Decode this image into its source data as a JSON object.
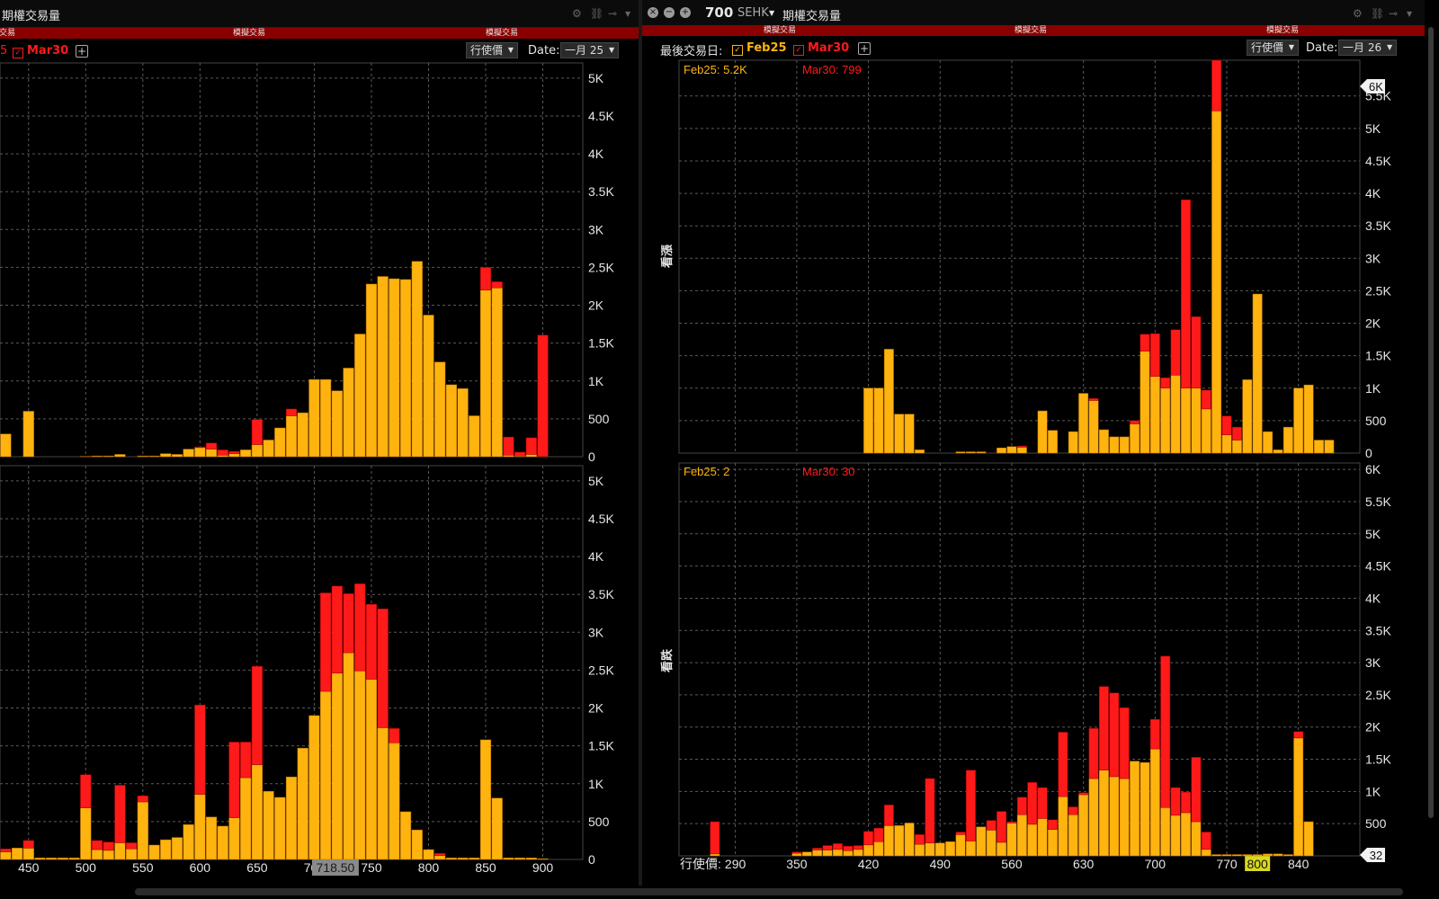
{
  "left_window": {
    "title": "期權交易量",
    "red_bar_labels": [
      "交易",
      "模擬交易",
      "模擬交易"
    ],
    "expiry_partial": "5",
    "expiry_mar": "Mar30",
    "sort_dropdown": "行使價",
    "date_label": "Date:",
    "date_value": "一月 25",
    "cursor_price": "718.50"
  },
  "right_window": {
    "symbol": "700",
    "exchange": "SEHK",
    "title": "期權交易量",
    "red_bar_labels": [
      "模擬交易",
      "模擬交易",
      "模擬交易"
    ],
    "expiry_label": "最後交易日:",
    "expiry_feb": "Feb25",
    "expiry_mar": "Mar30",
    "sort_dropdown": "行使價",
    "date_label": "Date:",
    "date_value": "一月 26",
    "top_chart": {
      "side_label": "看漲",
      "legend_feb": "Feb25: 5.2K",
      "legend_mar": "Mar30: 799",
      "max_marker": "6K",
      "extra_tick": "6K"
    },
    "bottom_chart": {
      "side_label": "看跌",
      "legend_feb": "Feb25: 2",
      "legend_mar": "Mar30: 30",
      "min_marker": "32"
    },
    "x_axis_title": "行使價",
    "highlight_tick": "800"
  },
  "icons": [
    "gear-icon",
    "link-icon",
    "pin-icon",
    "chevron-down-icon",
    "plus-icon",
    "close-icon",
    "minimize-icon",
    "zoom-icon"
  ],
  "colors": {
    "feb": "#FFB30F",
    "mar": "#FF1A1A",
    "red_bar": "#8a0000",
    "grid": "#5a5a5a",
    "highlight": "#d8d820"
  },
  "chart_data": [
    {
      "type": "bar",
      "stacked": true,
      "title": "",
      "panel": "left-top",
      "x_ticks": [
        450,
        500,
        550,
        600,
        650,
        700,
        750,
        800,
        850,
        900
      ],
      "xlim": [
        425,
        935
      ],
      "ylim": [
        0,
        5200
      ],
      "y_ticks": [
        "0",
        "500",
        "1K",
        "1.5K",
        "2K",
        "2.5K",
        "3K",
        "3.5K",
        "4K",
        "4.5K",
        "5K"
      ],
      "x": [
        430,
        440,
        450,
        460,
        470,
        480,
        490,
        500,
        510,
        520,
        530,
        540,
        550,
        560,
        570,
        580,
        590,
        600,
        610,
        620,
        630,
        640,
        650,
        660,
        670,
        680,
        690,
        700,
        710,
        720,
        730,
        740,
        750,
        760,
        770,
        780,
        790,
        800,
        810,
        820,
        830,
        840,
        850,
        860,
        870,
        880,
        890,
        900
      ],
      "series": [
        {
          "name": "Feb25",
          "values": [
            300,
            0,
            600,
            0,
            0,
            0,
            0,
            5,
            10,
            10,
            30,
            0,
            10,
            10,
            40,
            30,
            100,
            120,
            100,
            20,
            40,
            90,
            160,
            220,
            380,
            540,
            580,
            1020,
            1020,
            870,
            1170,
            1620,
            2280,
            2380,
            2350,
            2340,
            2580,
            1870,
            1250,
            950,
            900,
            540,
            2200,
            2230,
            20,
            10,
            30,
            5
          ]
        },
        {
          "name": "Mar30",
          "values": [
            0,
            0,
            0,
            0,
            0,
            0,
            0,
            0,
            0,
            0,
            0,
            0,
            0,
            0,
            0,
            0,
            0,
            10,
            80,
            70,
            30,
            0,
            330,
            0,
            0,
            90,
            0,
            0,
            0,
            0,
            0,
            0,
            0,
            0,
            0,
            0,
            0,
            0,
            0,
            0,
            0,
            0,
            300,
            80,
            240,
            50,
            220,
            1600
          ]
        }
      ]
    },
    {
      "type": "bar",
      "stacked": true,
      "title": "",
      "panel": "left-bottom",
      "x_ticks": [
        450,
        500,
        550,
        600,
        650,
        700,
        750,
        800,
        850,
        900
      ],
      "xlim": [
        425,
        935
      ],
      "ylim": [
        0,
        5200
      ],
      "y_ticks": [
        "0",
        "500",
        "1K",
        "1.5K",
        "2K",
        "2.5K",
        "3K",
        "3.5K",
        "4K",
        "4.5K",
        "5K"
      ],
      "x": [
        430,
        440,
        450,
        460,
        470,
        480,
        490,
        500,
        510,
        520,
        530,
        540,
        550,
        560,
        570,
        580,
        590,
        600,
        610,
        620,
        630,
        640,
        650,
        660,
        670,
        680,
        690,
        700,
        710,
        720,
        730,
        740,
        750,
        760,
        770,
        780,
        790,
        800,
        810,
        820,
        830,
        840,
        850,
        860,
        870,
        880,
        890,
        900
      ],
      "series": [
        {
          "name": "Feb25",
          "values": [
            100,
            150,
            150,
            20,
            20,
            20,
            20,
            680,
            130,
            120,
            220,
            140,
            760,
            190,
            260,
            290,
            460,
            860,
            560,
            440,
            550,
            1080,
            1250,
            900,
            820,
            1090,
            1470,
            1900,
            2220,
            2460,
            2730,
            2490,
            2380,
            1740,
            1540,
            630,
            390,
            130,
            50,
            20,
            20,
            20,
            1580,
            810,
            20,
            20,
            20,
            10
          ]
        },
        {
          "name": "Mar30",
          "values": [
            40,
            0,
            100,
            0,
            0,
            0,
            0,
            440,
            120,
            110,
            760,
            80,
            80,
            0,
            0,
            0,
            0,
            1180,
            0,
            0,
            1000,
            470,
            1300,
            0,
            0,
            0,
            0,
            0,
            1300,
            1150,
            780,
            1150,
            990,
            1570,
            190,
            0,
            0,
            0,
            30,
            0,
            0,
            0,
            0,
            0,
            0,
            0,
            0,
            0
          ]
        }
      ]
    },
    {
      "type": "bar",
      "stacked": true,
      "title": "",
      "panel": "right-top",
      "x_ticks": [
        290,
        350,
        420,
        490,
        560,
        630,
        700,
        770,
        840
      ],
      "xlim": [
        235,
        900
      ],
      "ylim": [
        0,
        6050
      ],
      "y_ticks": [
        "0",
        "500",
        "1K",
        "1.5K",
        "2K",
        "2.5K",
        "3K",
        "3.5K",
        "4K",
        "4.5K",
        "5K",
        "5.5K"
      ],
      "x": [
        400,
        410,
        420,
        430,
        440,
        450,
        460,
        470,
        480,
        490,
        500,
        510,
        520,
        530,
        540,
        550,
        560,
        570,
        580,
        590,
        600,
        610,
        620,
        630,
        640,
        650,
        660,
        670,
        680,
        690,
        700,
        710,
        720,
        730,
        740,
        750,
        760,
        770,
        780,
        790,
        800,
        810,
        820,
        830,
        840,
        850,
        860,
        870,
        880
      ],
      "series": [
        {
          "name": "Feb25",
          "values": [
            0,
            0,
            1000,
            1000,
            1600,
            600,
            600,
            50,
            0,
            0,
            0,
            20,
            20,
            20,
            0,
            80,
            100,
            90,
            0,
            650,
            350,
            0,
            330,
            920,
            810,
            360,
            250,
            250,
            450,
            1570,
            1180,
            1000,
            1200,
            1000,
            1000,
            680,
            5270,
            280,
            200,
            1130,
            2450,
            330,
            50,
            400,
            1000,
            1050,
            200,
            200,
            0
          ]
        },
        {
          "name": "Mar30",
          "values": [
            0,
            0,
            0,
            0,
            0,
            0,
            0,
            0,
            0,
            0,
            0,
            0,
            0,
            0,
            0,
            0,
            0,
            20,
            0,
            0,
            0,
            0,
            0,
            0,
            30,
            0,
            0,
            0,
            50,
            260,
            660,
            160,
            700,
            2900,
            1100,
            290,
            780,
            290,
            200,
            0,
            0,
            0,
            0,
            0,
            0,
            0,
            0,
            0,
            0
          ]
        }
      ]
    },
    {
      "type": "bar",
      "stacked": true,
      "title": "",
      "panel": "right-bottom",
      "x_ticks": [
        290,
        350,
        420,
        490,
        560,
        630,
        700,
        770,
        800,
        840
      ],
      "xlim": [
        235,
        900
      ],
      "ylim": [
        0,
        6100
      ],
      "y_ticks": [
        "0",
        "500",
        "1K",
        "1.5K",
        "2K",
        "2.5K",
        "3K",
        "3.5K",
        "4K",
        "4.5K",
        "5K",
        "5.5K",
        "6K"
      ],
      "x": [
        270,
        280,
        290,
        300,
        310,
        320,
        330,
        340,
        350,
        360,
        370,
        380,
        390,
        400,
        410,
        420,
        430,
        440,
        450,
        460,
        470,
        480,
        490,
        500,
        510,
        520,
        530,
        540,
        550,
        560,
        570,
        580,
        590,
        600,
        610,
        620,
        630,
        640,
        650,
        660,
        670,
        680,
        690,
        700,
        710,
        720,
        730,
        740,
        750,
        760,
        770,
        780,
        790,
        800,
        810,
        820,
        830,
        840,
        850
      ],
      "series": [
        {
          "name": "Feb25",
          "values": [
            30,
            0,
            0,
            0,
            0,
            0,
            0,
            0,
            40,
            60,
            90,
            90,
            100,
            80,
            100,
            170,
            220,
            470,
            470,
            510,
            180,
            200,
            200,
            220,
            330,
            230,
            450,
            400,
            210,
            510,
            640,
            490,
            580,
            410,
            920,
            640,
            950,
            1200,
            1330,
            1230,
            1200,
            1470,
            1450,
            1660,
            750,
            630,
            670,
            530,
            100,
            20,
            20,
            20,
            20,
            20,
            30,
            30,
            20,
            1830,
            530
          ]
        },
        {
          "name": "Mar30",
          "values": [
            500,
            0,
            0,
            0,
            0,
            0,
            0,
            0,
            20,
            0,
            30,
            70,
            90,
            70,
            60,
            210,
            210,
            320,
            0,
            0,
            150,
            1000,
            0,
            0,
            40,
            1100,
            0,
            150,
            480,
            20,
            270,
            650,
            480,
            150,
            1000,
            120,
            30,
            780,
            1300,
            1300,
            1100,
            0,
            0,
            460,
            2350,
            430,
            320,
            1000,
            270,
            0,
            0,
            0,
            0,
            0,
            0,
            0,
            0,
            100,
            0
          ]
        }
      ]
    }
  ]
}
